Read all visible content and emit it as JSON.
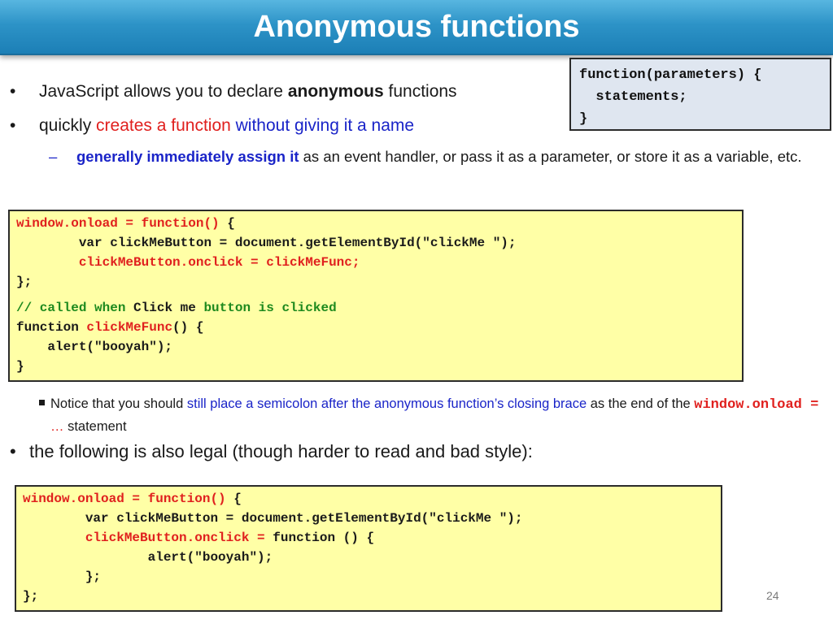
{
  "slide": {
    "title": "Anonymous functions",
    "page_number": "24"
  },
  "syntax": {
    "line1": "function(parameters) {",
    "line2": "  statements;",
    "line3": "}"
  },
  "bullets": {
    "b1_pre": "JavaScript allows you to declare ",
    "b1_bold": "anonymous",
    "b1_post": " functions",
    "b2_pre": "quickly ",
    "b2_red": "creates a function",
    "b2_blue": " without giving it a name",
    "sub_bold": "generally immediately assign it",
    "sub_rest": " as an event handler, or pass it as a parameter, or store it as a variable, etc.",
    "b3": "the following is also legal (though harder to read and bad style):"
  },
  "code1": {
    "l1_red": "window.onload = function()",
    "l1_black": " {",
    "l2": "        var clickMeButton = document.getElementById(\"clickMe \");",
    "l3_red": "        clickMeButton.onclick = clickMeFunc;",
    "l4": "};",
    "l5_green1": "// called when ",
    "l5_black": "Click me",
    "l5_green2": " button is clicked",
    "l6_a": "function ",
    "l6_red": "clickMeFunc",
    "l6_b": "() {",
    "l7": "    alert(\"booyah\");",
    "l8": "}"
  },
  "notice": {
    "pre": "Notice that you should ",
    "blue": "still place a semicolon after the anonymous function’s closing brace",
    "mid": " as the end of the ",
    "code": "window.onload = ",
    "ellipsis": "…",
    "post": "  statement"
  },
  "code2": {
    "l1_red": "window.onload = function()",
    "l1_black": " {",
    "l2": "        var clickMeButton = document.getElementById(\"clickMe \");",
    "l3_red": "        clickMeButton.onclick =",
    "l3_black": " function () {",
    "l4": "                alert(\"booyah\");",
    "l5": "        };",
    "l6": "};"
  }
}
